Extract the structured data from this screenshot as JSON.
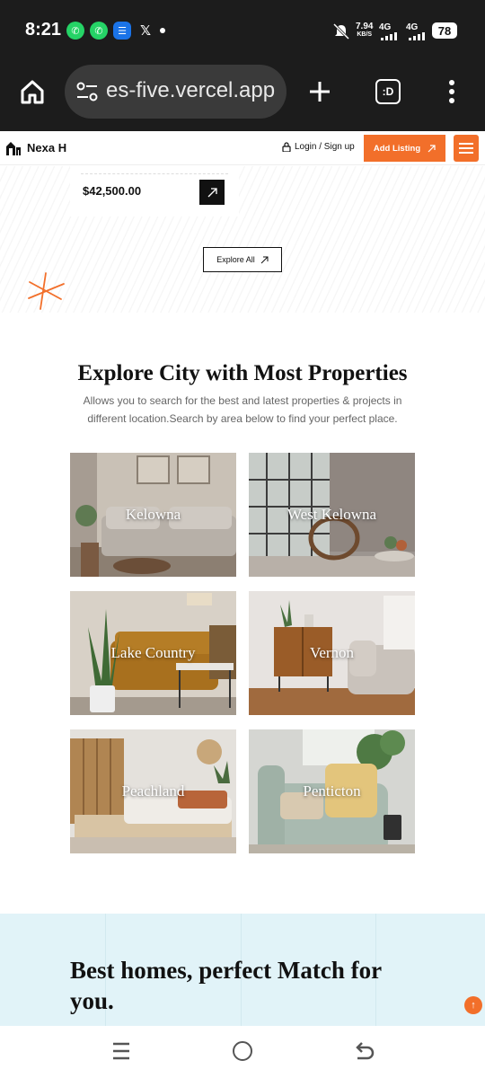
{
  "status_bar": {
    "time": "8:21",
    "notifications": [
      "whatsapp-icon",
      "whatsapp-icon",
      "messages-icon",
      "x-icon"
    ],
    "speed_value": "7.94",
    "speed_unit": "KB/S",
    "network1": "4G",
    "network2": "4G",
    "battery": "78"
  },
  "browser": {
    "url": "es-five.vercel.app",
    "tabs_label": ":D"
  },
  "site_header": {
    "logo": "Nexa H",
    "login": "Login / Sign up",
    "add_listing": "Add Listing"
  },
  "listing": {
    "price": "$42,500.00",
    "explore_all": "Explore All"
  },
  "cities_section": {
    "title": "Explore City with Most Properties",
    "description": "Allows you to search for the best and latest properties & projects in different location.Search by area below to find your perfect place.",
    "cities": [
      {
        "name": "Kelowna"
      },
      {
        "name": "West Kelowna"
      },
      {
        "name": "Lake Country"
      },
      {
        "name": "Vernon"
      },
      {
        "name": "Peachland"
      },
      {
        "name": "Penticton"
      }
    ]
  },
  "banner": {
    "title": "Best homes, perfect Match for you."
  },
  "colors": {
    "accent": "#f26f2a",
    "banner_bg": "#e1f3f8",
    "dark": "#1c1c1c"
  }
}
